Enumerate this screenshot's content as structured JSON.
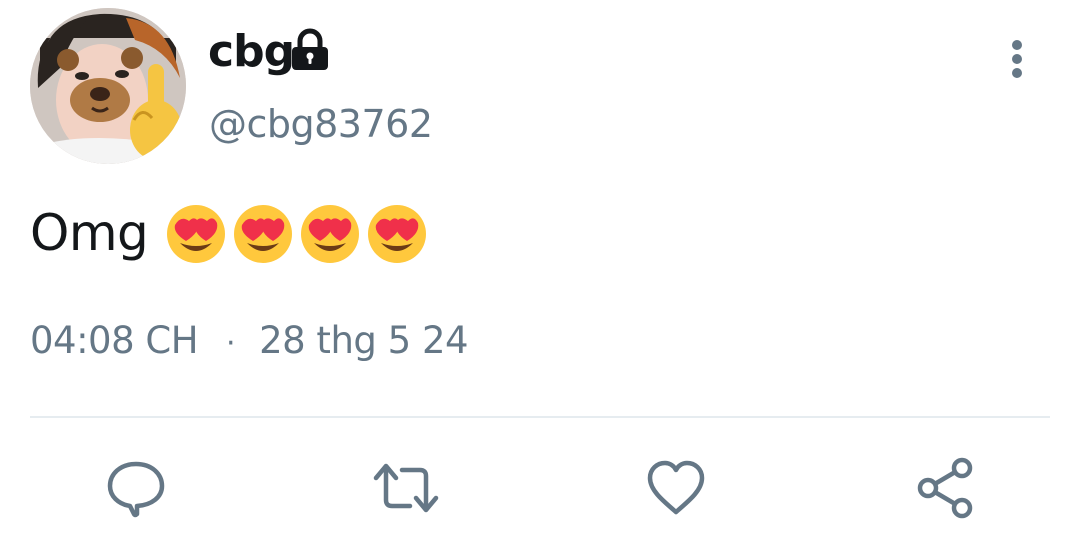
{
  "tweet": {
    "display_name": "cbg",
    "handle": "@cbg83762",
    "protected_icon": "lock-icon",
    "text": "Omg",
    "emoji": [
      "smiling-face-with-heart-eyes",
      "smiling-face-with-heart-eyes",
      "smiling-face-with-heart-eyes",
      "smiling-face-with-heart-eyes"
    ],
    "time": "04:08 CH",
    "separator": "·",
    "date": "28 thg 5 24"
  },
  "actions": {
    "reply_icon": "speech-bubble-icon",
    "retweet_icon": "retweet-icon",
    "like_icon": "heart-icon",
    "share_icon": "share-icon"
  },
  "menu": {
    "icon": "vertical-ellipsis-icon"
  },
  "colors": {
    "text_primary": "#14171a",
    "text_secondary": "#657786",
    "divider": "#e6ecf0",
    "icon": "#657786",
    "emoji_face": "#ffc83d",
    "emoji_heart": "#f0304a"
  }
}
